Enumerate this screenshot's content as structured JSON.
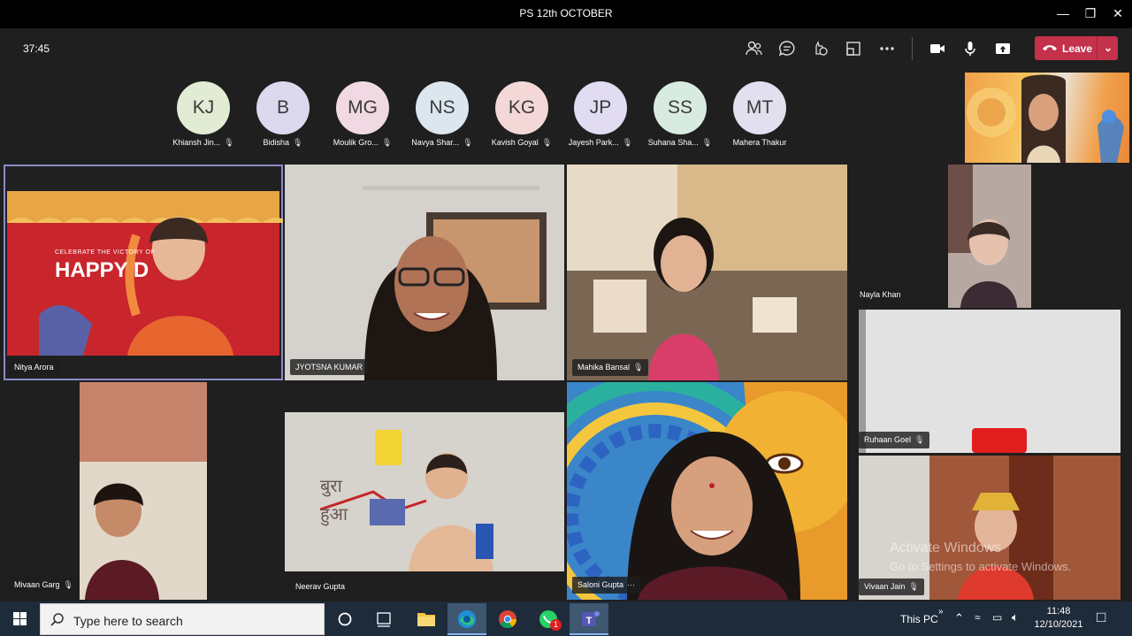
{
  "window": {
    "title": "PS 12th OCTOBER"
  },
  "toolbar": {
    "timer": "37:45",
    "icons": [
      "people-icon",
      "chat-icon",
      "reactions-icon",
      "rooms-icon",
      "more-icon",
      "camera-icon",
      "mic-icon",
      "share-icon"
    ],
    "leave_label": "Leave"
  },
  "participants": [
    {
      "initials": "KJ",
      "name": "Khiansh Jin...",
      "color": "#e2ebd4"
    },
    {
      "initials": "B",
      "name": "Bidisha",
      "color": "#dcd8ee"
    },
    {
      "initials": "MG",
      "name": "Moulik Gro...",
      "color": "#f1d9e3"
    },
    {
      "initials": "NS",
      "name": "Navya Shar...",
      "color": "#dbe6ee"
    },
    {
      "initials": "KG",
      "name": "Kavish Goyal",
      "color": "#f4d7d7"
    },
    {
      "initials": "JP",
      "name": "Jayesh Park...",
      "color": "#e1dcf1"
    },
    {
      "initials": "SS",
      "name": "Suhana Sha...",
      "color": "#d8ebe0"
    },
    {
      "initials": "MT",
      "name": "Mahera Thakur",
      "color": "#e2dfee"
    }
  ],
  "tiles": {
    "nitya": "Nitya Arora",
    "jyotsna": "JYOTSNA KUMAR",
    "mahika": "Mahika Bansal",
    "nayla": "Nayla Khan",
    "ruhaan": "Ruhaan Goel",
    "mivaan": "Mivaan Garg",
    "neerav": "Neerav Gupta",
    "saloni": "Saloni Gupta",
    "vivaan": "Vivaan Jain"
  },
  "backgrounds": {
    "nitya_banner_line1": "CELEBRATE THE VICTORY OF",
    "nitya_banner_line2": "HAPPY D"
  },
  "watermark": {
    "line1": "Activate Windows",
    "line2": "Go to Settings to activate Windows."
  },
  "taskbar": {
    "search_placeholder": "Type here to search",
    "this_pc": "This PC",
    "time": "11:48",
    "date": "12/10/2021",
    "whatsapp_badge": "1"
  }
}
